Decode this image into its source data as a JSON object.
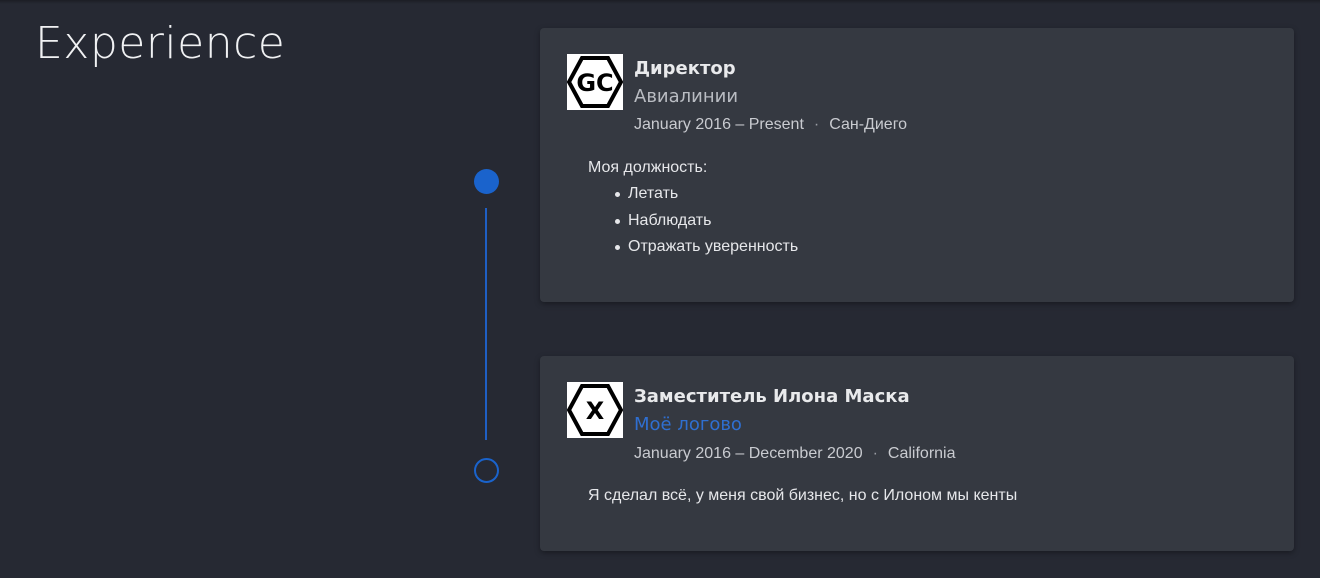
{
  "section": {
    "title": "Experience"
  },
  "experience": [
    {
      "logo_icon": "gc-hexagon-logo-icon",
      "logo_text": "GC",
      "title": "Директор",
      "company": "Авиалинии",
      "company_is_link": false,
      "dates": "January 2016 – Present",
      "separator": "·",
      "location": "Сан-Диего",
      "description": "Моя должность:",
      "bullets": [
        "Летать",
        "Наблюдать",
        "Отражать уверенность"
      ],
      "marker": "filled"
    },
    {
      "logo_icon": "x-hexagon-logo-icon",
      "logo_text": "X",
      "title": "Заместитель Илона Маска",
      "company": "Моё логово",
      "company_is_link": true,
      "dates": "January 2016 – December 2020",
      "separator": "·",
      "location": "California",
      "description": "Я сделал всё, у меня свой бизнес, но с Илоном мы кенты",
      "bullets": [],
      "marker": "outline"
    }
  ],
  "colors": {
    "background": "#262933",
    "card": "#353941",
    "accent": "#1a63cc",
    "link": "#2f6fd1"
  }
}
